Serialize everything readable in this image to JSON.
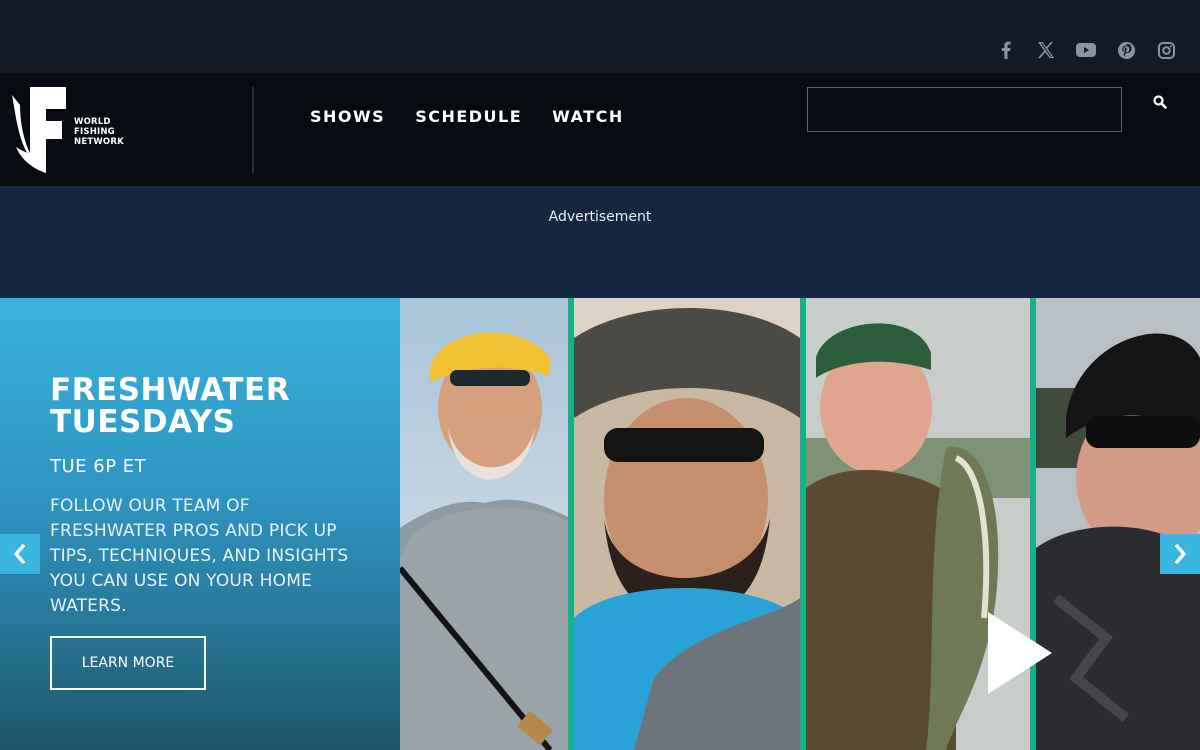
{
  "social": {
    "items": [
      {
        "name": "facebook"
      },
      {
        "name": "x"
      },
      {
        "name": "youtube"
      },
      {
        "name": "pinterest"
      },
      {
        "name": "instagram"
      }
    ]
  },
  "header": {
    "logo_text": "WORLD FISHING NETWORK",
    "nav": [
      "SHOWS",
      "SCHEDULE",
      "WATCH"
    ],
    "search_value": ""
  },
  "ad": {
    "label": "Advertisement"
  },
  "hero": {
    "title": "FRESHWATER TUESDAYS",
    "time": "TUE 6P ET",
    "description": "FOLLOW OUR TEAM OF FRESHWATER PROS AND PICK UP TIPS, TECHNIQUES, AND INSIGHTS YOU CAN USE ON YOUR HOME WATERS.",
    "button": "LEARN MORE"
  },
  "colors": {
    "accent": "#38b3dd",
    "separator": "#16b08a",
    "nav_bg": "#070b11",
    "ad_bg": "#152640"
  }
}
